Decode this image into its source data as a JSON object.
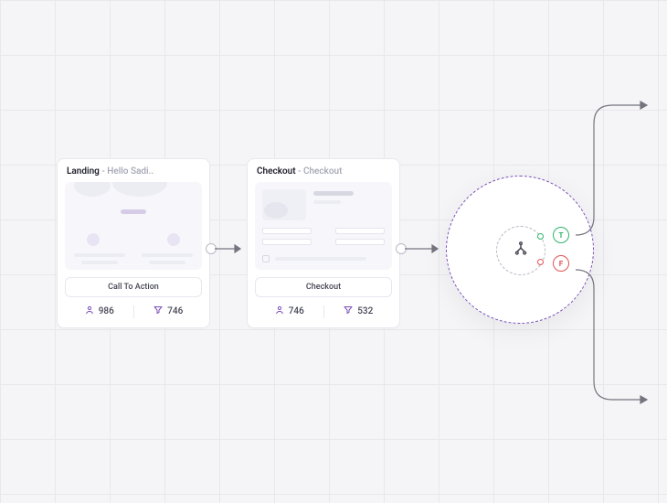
{
  "cards": [
    {
      "title_strong": "Landing",
      "title_sep": " - ",
      "title_sub": "Hello Sadi..",
      "action_label": "Call To Action",
      "stats": {
        "users": "986",
        "converted": "746"
      }
    },
    {
      "title_strong": "Checkout",
      "title_sep": " - ",
      "title_sub": "Checkout",
      "action_label": "Checkout",
      "stats": {
        "users": "746",
        "converted": "532"
      }
    }
  ],
  "split": {
    "true_label": "T",
    "false_label": "F"
  },
  "colors": {
    "purple": "#7a4eb8",
    "green": "#2fb36a",
    "red": "#e25353",
    "arrow": "#74747f"
  }
}
